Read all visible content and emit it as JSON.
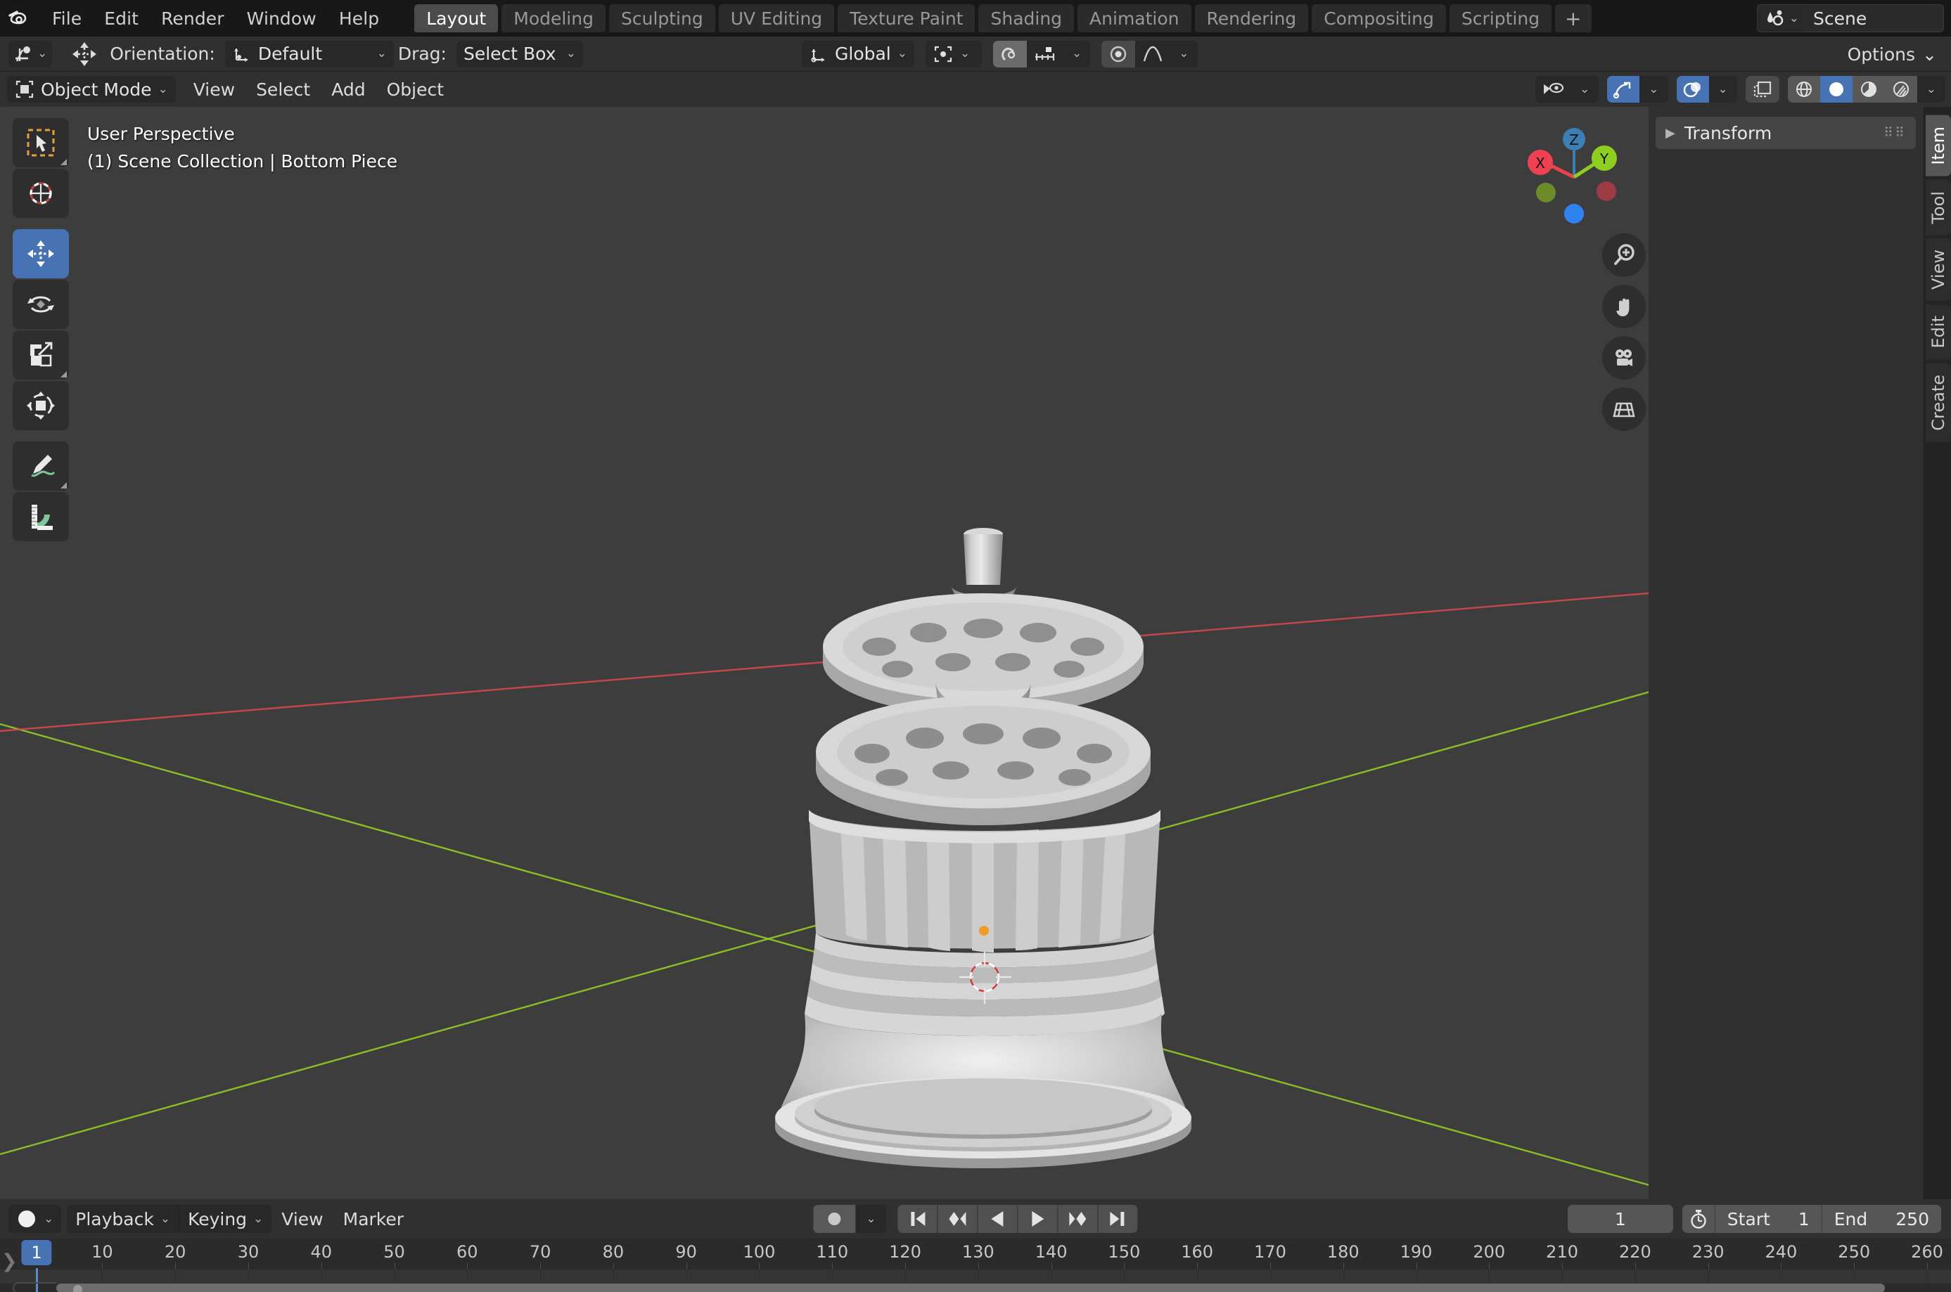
{
  "app": {
    "logo_icon": "blender-logo-icon",
    "menus": [
      "File",
      "Edit",
      "Render",
      "Window",
      "Help"
    ],
    "workspace_tabs": [
      {
        "label": "Layout",
        "active": true
      },
      {
        "label": "Modeling",
        "active": false
      },
      {
        "label": "Sculpting",
        "active": false
      },
      {
        "label": "UV Editing",
        "active": false
      },
      {
        "label": "Texture Paint",
        "active": false
      },
      {
        "label": "Shading",
        "active": false
      },
      {
        "label": "Animation",
        "active": false
      },
      {
        "label": "Rendering",
        "active": false
      },
      {
        "label": "Compositing",
        "active": false
      },
      {
        "label": "Scripting",
        "active": false
      }
    ],
    "add_workspace_label": "+",
    "scene": {
      "icon": "scene-data-icon",
      "name": "Scene"
    }
  },
  "tool_settings": {
    "active_tool_icon": "move-tool-icon",
    "gizmo_icon": "move-gizmo-icon",
    "orientation_label": "Orientation:",
    "orientation_value": "Default",
    "drag_label": "Drag:",
    "drag_value": "Select Box",
    "transform_orientation_value": "Global",
    "pivot_icon": "pivot-point-icon",
    "snap_magnet_icon": "snap-magnet-icon",
    "snap_target_icon": "snap-increment-icon",
    "proportional_icon": "proportional-edit-icon",
    "falloff_icon": "smooth-falloff-icon",
    "options_label": "Options"
  },
  "viewport_header": {
    "mode_icon": "object-mode-icon",
    "mode_value": "Object Mode",
    "menus": [
      "View",
      "Select",
      "Add",
      "Object"
    ],
    "visibility_icon": "object-visibility-icon",
    "gizmo_toggle_icon": "show-gizmo-icon",
    "gizmo_toggle_on": true,
    "overlays_icon": "show-overlays-icon",
    "overlays_on": true,
    "xray_icon": "toggle-xray-icon",
    "shading_modes": [
      {
        "icon": "wireframe-shading-icon",
        "active": false
      },
      {
        "icon": "solid-shading-icon",
        "active": true
      },
      {
        "icon": "material-preview-shading-icon",
        "active": false
      },
      {
        "icon": "rendered-shading-icon",
        "active": false
      }
    ]
  },
  "viewport": {
    "perspective_label": "User Perspective",
    "collection_label": "(1) Scene Collection | Bottom Piece",
    "background_color": "#3d3d3d",
    "axis_x_color": "#e0484e",
    "axis_y_color": "#96d623",
    "tools": [
      {
        "name": "tweak-select-tool",
        "icon": "cursor-arrow-icon",
        "active": false,
        "has_submenu": true
      },
      {
        "name": "cursor-tool",
        "icon": "3d-cursor-icon",
        "active": false,
        "has_submenu": false
      },
      {
        "name": "move-tool",
        "icon": "move-arrows-icon",
        "active": true,
        "has_submenu": false
      },
      {
        "name": "rotate-tool",
        "icon": "rotate-arrows-icon",
        "active": false,
        "has_submenu": false
      },
      {
        "name": "scale-tool",
        "icon": "scale-corner-icon",
        "active": false,
        "has_submenu": true
      },
      {
        "name": "transform-tool",
        "icon": "transform-box-icon",
        "active": false,
        "has_submenu": false
      },
      {
        "name": "annotate-tool",
        "icon": "pencil-annotate-icon",
        "active": false,
        "has_submenu": true
      },
      {
        "name": "measure-tool",
        "icon": "ruler-measure-icon",
        "active": false,
        "has_submenu": false
      }
    ],
    "gizmo": {
      "axes": [
        {
          "label": "Z",
          "color": "#3b7fb5"
        },
        {
          "label": "Y",
          "color": "#8ece22"
        },
        {
          "label": "X",
          "color": "#f04152"
        },
        {
          "label": "",
          "color": "#6c8c28"
        },
        {
          "label": "",
          "color": "#9c3b46"
        },
        {
          "label": "",
          "color": "#2f83ef"
        }
      ]
    },
    "nav_buttons": [
      {
        "name": "zoom-view-button",
        "icon": "zoom-magnifier-icon"
      },
      {
        "name": "pan-view-button",
        "icon": "hand-pan-icon"
      },
      {
        "name": "camera-view-button",
        "icon": "camera-icon"
      },
      {
        "name": "toggle-perspective-button",
        "icon": "ortho-grid-icon"
      }
    ]
  },
  "sidebar": {
    "panel_title": "Transform",
    "collapsed": true,
    "tabs": [
      {
        "label": "Item",
        "active": true
      },
      {
        "label": "Tool",
        "active": false
      },
      {
        "label": "View",
        "active": false
      },
      {
        "label": "Edit",
        "active": false
      },
      {
        "label": "Create",
        "active": false
      }
    ]
  },
  "timeline": {
    "editor_icon": "timeline-editor-icon",
    "menus": [
      {
        "label": "Playback",
        "has_chevron": true
      },
      {
        "label": "Keying",
        "has_chevron": true
      },
      {
        "label": "View",
        "has_chevron": false
      },
      {
        "label": "Marker",
        "has_chevron": false
      }
    ],
    "record_icon": "auto-keying-record-icon",
    "playback_buttons": [
      {
        "name": "jump-to-start-button",
        "icon": "jump-start-icon"
      },
      {
        "name": "jump-to-previous-keyframe-button",
        "icon": "prev-keyframe-icon"
      },
      {
        "name": "play-reverse-button",
        "icon": "play-reverse-icon"
      },
      {
        "name": "play-button",
        "icon": "play-icon"
      },
      {
        "name": "jump-to-next-keyframe-button",
        "icon": "next-keyframe-icon"
      },
      {
        "name": "jump-to-end-button",
        "icon": "jump-end-icon"
      }
    ],
    "current_frame": "1",
    "use_preview_range_icon": "stopwatch-icon",
    "start_label": "Start",
    "start_value": "1",
    "end_label": "End",
    "end_value": "250",
    "playhead_frame": "1",
    "ruler_ticks": [
      "10",
      "20",
      "30",
      "40",
      "50",
      "60",
      "70",
      "80",
      "90",
      "100",
      "110",
      "120",
      "130",
      "140",
      "150",
      "160",
      "170",
      "180",
      "190",
      "200",
      "210",
      "220",
      "230",
      "240",
      "250",
      "260"
    ],
    "accent_color": "#4772b3"
  }
}
